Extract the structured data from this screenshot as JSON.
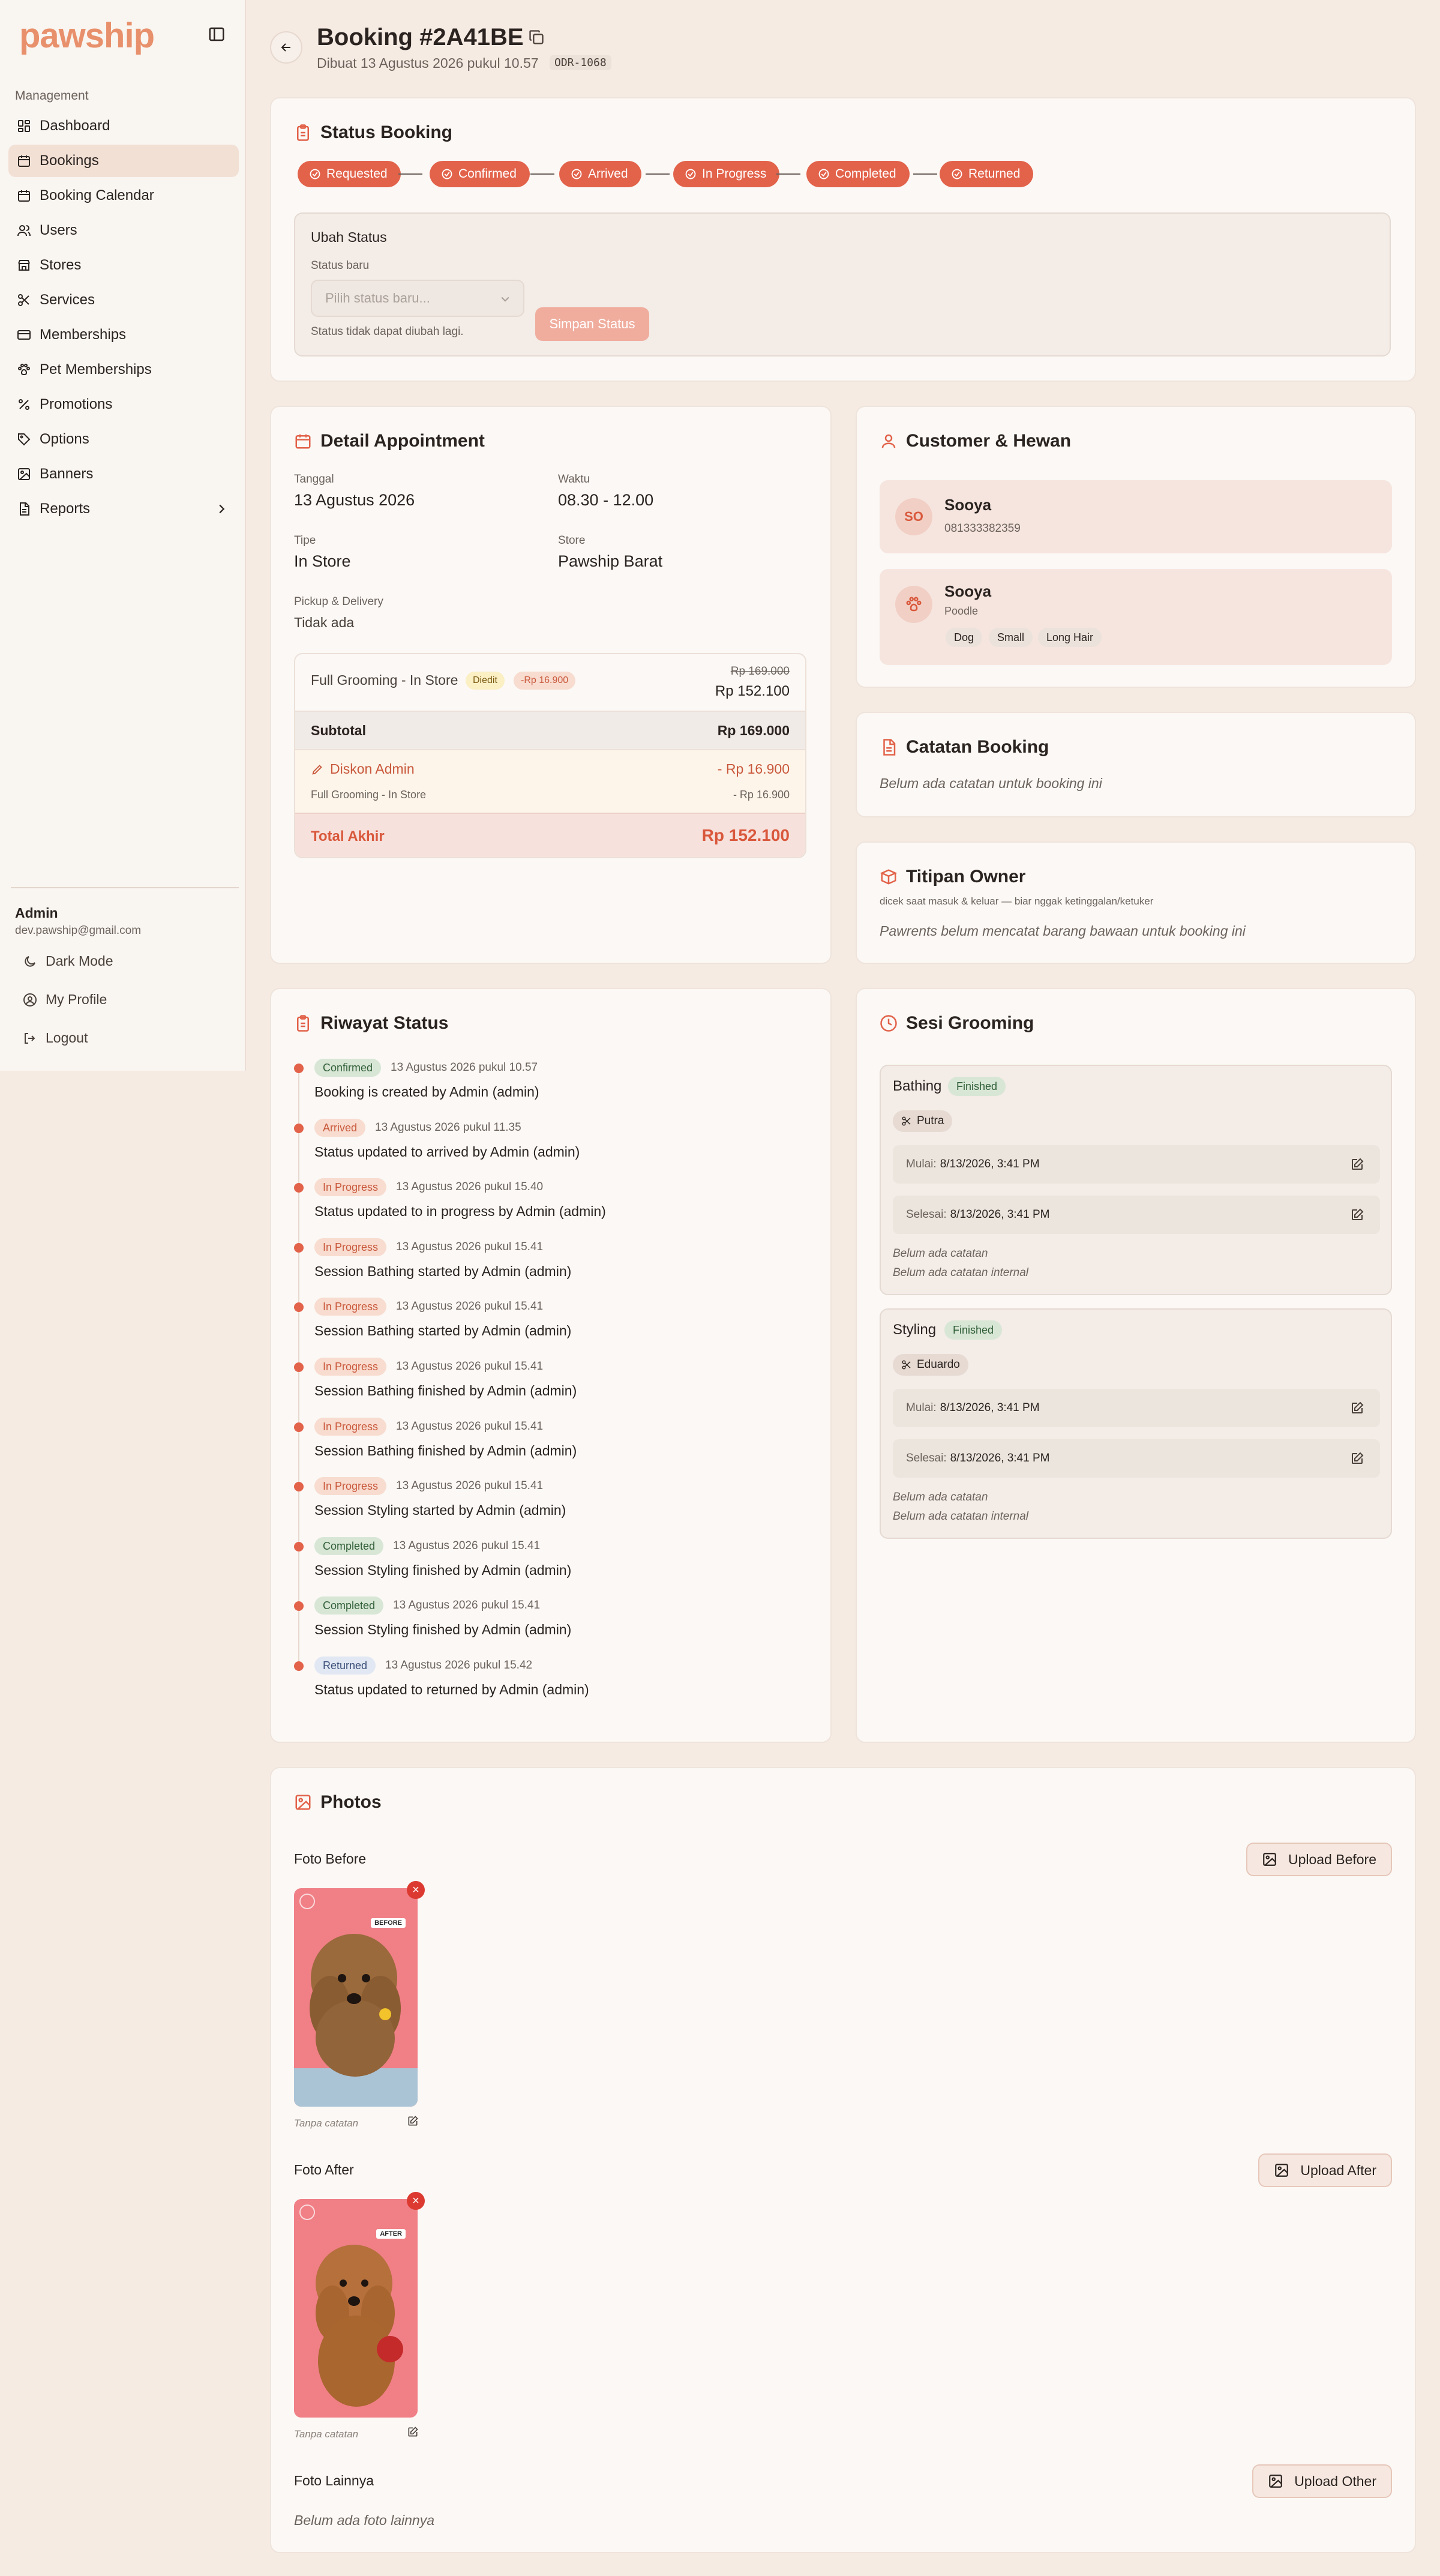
{
  "app": {
    "logo": "pawship"
  },
  "sidebar": {
    "group_label": "Management",
    "items": [
      {
        "label": "Dashboard",
        "icon": "dashboard-icon"
      },
      {
        "label": "Bookings",
        "icon": "calendar-icon"
      },
      {
        "label": "Booking Calendar",
        "icon": "calendar-icon"
      },
      {
        "label": "Users",
        "icon": "users-icon"
      },
      {
        "label": "Stores",
        "icon": "store-icon"
      },
      {
        "label": "Services",
        "icon": "scissors-icon"
      },
      {
        "label": "Memberships",
        "icon": "card-icon"
      },
      {
        "label": "Pet Memberships",
        "icon": "paw-icon"
      },
      {
        "label": "Promotions",
        "icon": "percent-icon"
      },
      {
        "label": "Options",
        "icon": "tag-icon"
      },
      {
        "label": "Banners",
        "icon": "image-icon"
      },
      {
        "label": "Reports",
        "icon": "report-icon"
      }
    ],
    "user": {
      "name": "Admin",
      "email": "dev.pawship@gmail.com"
    },
    "actions": {
      "dark_mode": "Dark Mode",
      "profile": "My Profile",
      "logout": "Logout"
    }
  },
  "header": {
    "title": "Booking #2A41BE",
    "created": "Dibuat 13 Agustus 2026 pukul 10.57",
    "order_code": "ODR-1068"
  },
  "status_card": {
    "title": "Status Booking",
    "steps": [
      "Requested",
      "Confirmed",
      "Arrived",
      "In Progress",
      "Completed",
      "Returned"
    ],
    "ubah": {
      "title": "Ubah Status",
      "label": "Status baru",
      "placeholder": "Pilih status baru...",
      "button": "Simpan Status",
      "note": "Status tidak dapat diubah lagi."
    }
  },
  "appointment": {
    "title": "Detail Appointment",
    "tanggal_label": "Tanggal",
    "tanggal": "13 Agustus 2026",
    "waktu_label": "Waktu",
    "waktu": "08.30 - 12.00",
    "tipe_label": "Tipe",
    "tipe": "In Store",
    "store_label": "Store",
    "store": "Pawship Barat",
    "pickup_label": "Pickup & Delivery",
    "pickup": "Tidak ada",
    "service": {
      "name": "Full Grooming - In Store",
      "badge_edit": "Diedit",
      "badge_discount": "-Rp 16.900",
      "old_price": "Rp 169.000",
      "new_price": "Rp 152.100"
    },
    "subtotal_label": "Subtotal",
    "subtotal": "Rp 169.000",
    "diskon_label": "Diskon Admin",
    "diskon": "- Rp 16.900",
    "diskon_sub": "Full Grooming - In Store",
    "diskon_sub_val": "- Rp 16.900",
    "total_label": "Total Akhir",
    "total": "Rp 152.100"
  },
  "customer": {
    "title": "Customer & Hewan",
    "initials": "SO",
    "name": "Sooya",
    "phone": "081333382359",
    "pet": {
      "name": "Sooya",
      "breed": "Poodle",
      "tags": [
        "Dog",
        "Small",
        "Long Hair"
      ]
    }
  },
  "catatan": {
    "title": "Catatan Booking",
    "empty": "Belum ada catatan untuk booking ini"
  },
  "titipan": {
    "title": "Titipan Owner",
    "subtitle": "dicek saat masuk & keluar — biar nggak ketinggalan/ketuker",
    "empty": "Pawrents belum mencatat barang bawaan untuk booking ini"
  },
  "riwayat": {
    "title": "Riwayat Status",
    "entries": [
      {
        "status": "Confirmed",
        "date": "13 Agustus 2026 pukul 10.57",
        "text": "Booking is created by Admin (admin)"
      },
      {
        "status": "Arrived",
        "date": "13 Agustus 2026 pukul 11.35",
        "text": "Status updated to arrived by Admin (admin)"
      },
      {
        "status": "In Progress",
        "date": "13 Agustus 2026 pukul 15.40",
        "text": "Status updated to in progress by Admin (admin)"
      },
      {
        "status": "In Progress",
        "date": "13 Agustus 2026 pukul 15.41",
        "text": "Session Bathing started by Admin (admin)"
      },
      {
        "status": "In Progress",
        "date": "13 Agustus 2026 pukul 15.41",
        "text": "Session Bathing started by Admin (admin)"
      },
      {
        "status": "In Progress",
        "date": "13 Agustus 2026 pukul 15.41",
        "text": "Session Bathing finished by Admin (admin)"
      },
      {
        "status": "In Progress",
        "date": "13 Agustus 2026 pukul 15.41",
        "text": "Session Bathing finished by Admin (admin)"
      },
      {
        "status": "In Progress",
        "date": "13 Agustus 2026 pukul 15.41",
        "text": "Session Styling started by Admin (admin)"
      },
      {
        "status": "Completed",
        "date": "13 Agustus 2026 pukul 15.41",
        "text": "Session Styling finished by Admin (admin)"
      },
      {
        "status": "Completed",
        "date": "13 Agustus 2026 pukul 15.41",
        "text": "Session Styling finished by Admin (admin)"
      },
      {
        "status": "Returned",
        "date": "13 Agustus 2026 pukul 15.42",
        "text": "Status updated to returned by Admin (admin)"
      }
    ]
  },
  "sesi": {
    "title": "Sesi Grooming",
    "sessions": [
      {
        "name": "Bathing",
        "status": "Finished",
        "groomer": "Putra",
        "mulai_label": "Mulai:",
        "mulai": "8/13/2026, 3:41 PM",
        "selesai_label": "Selesai:",
        "selesai": "8/13/2026, 3:41 PM",
        "note1": "Belum ada catatan",
        "note2": "Belum ada catatan internal"
      },
      {
        "name": "Styling",
        "status": "Finished",
        "groomer": "Eduardo",
        "mulai_label": "Mulai:",
        "mulai": "8/13/2026, 3:41 PM",
        "selesai_label": "Selesai:",
        "selesai": "8/13/2026, 3:41 PM",
        "note1": "Belum ada catatan",
        "note2": "Belum ada catatan internal"
      }
    ]
  },
  "photos": {
    "title": "Photos",
    "before_label": "Foto Before",
    "upload_before": "Upload Before",
    "before_caption": "Tanpa catatan",
    "before_stamp": "BEFORE",
    "after_label": "Foto After",
    "upload_after": "Upload After",
    "after_caption": "Tanpa catatan",
    "after_stamp": "AFTER",
    "other_label": "Foto Lainnya",
    "upload_other": "Upload Other",
    "other_empty": "Belum ada foto lainnya"
  },
  "colors": {
    "accent": "#e2624a",
    "background": "#f6ebe3",
    "card": "#fbf8f5",
    "logo": "#e8906b"
  }
}
